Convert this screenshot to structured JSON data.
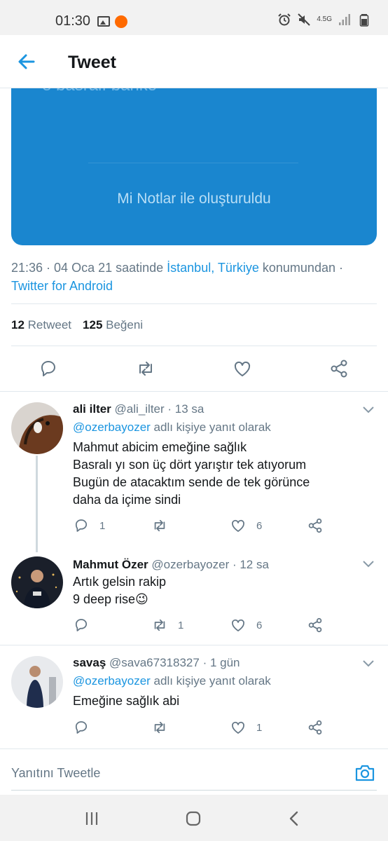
{
  "status_bar": {
    "time": "01:30",
    "network": "4.5G"
  },
  "header": {
    "title": "Tweet"
  },
  "media": {
    "top_text": "e basralı banko",
    "caption": "Mi Notlar ile oluşturuldu"
  },
  "tweet_meta": {
    "time_prefix": "21:36 · 04 Oca 21 saatinde ",
    "location": "İstanbul, Türkiye",
    "location_suffix": " konumundan ·",
    "source": "Twitter for Android"
  },
  "stats": {
    "retweet_count": "12",
    "retweet_label": "Retweet",
    "like_count": "125",
    "like_label": "Beğeni"
  },
  "replies": [
    {
      "name": "ali ilter",
      "handle": "@ali_ilter",
      "time": "· 13 sa",
      "reply_to": "@ozerbayozer",
      "reply_to_suffix": " adlı kişiye yanıt olarak",
      "lines": [
        "Mahmut abicim emeğine sağlık",
        "Basralı yı son üç dört yarıştır tek atıyorum",
        "Bugün de atacaktım sende de tek görünce",
        "daha da içime sindi"
      ],
      "reply_count": "1",
      "retweet_count": "",
      "like_count": "6"
    },
    {
      "name": "Mahmut Özer",
      "handle": "@ozerbayozer",
      "time": "· 12 sa",
      "lines": [
        "Artık gelsin rakip",
        "9 deep rise😉"
      ],
      "reply_count": "",
      "retweet_count": "1",
      "like_count": "6"
    },
    {
      "name": "savaş",
      "handle": "@sava67318327",
      "time": "· 1 gün",
      "reply_to": "@ozerbayozer",
      "reply_to_suffix": " adlı kişiye yanıt olarak",
      "lines": [
        "Emeğine sağlık abi"
      ],
      "reply_count": "",
      "retweet_count": "",
      "like_count": "1"
    }
  ],
  "composer": {
    "placeholder": "Yanıtını Tweetle"
  },
  "colors": {
    "accent": "#1b95e0",
    "text": "#14171a",
    "muted": "#657786",
    "media_bg": "#1a86cf"
  }
}
